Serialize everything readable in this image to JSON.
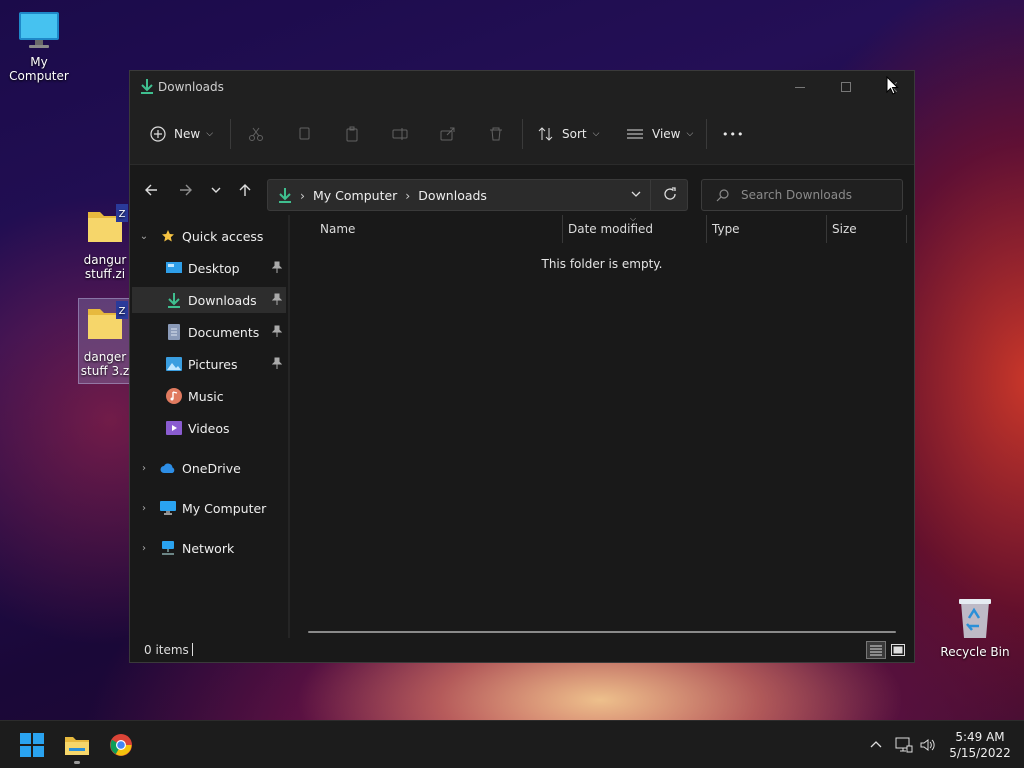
{
  "desktop": {
    "icons": [
      {
        "label": "My Computer"
      },
      {
        "label_line1": "dangur",
        "label_line2": "stuff.zi"
      },
      {
        "label_line1": "danger",
        "label_line2": "stuff 3.z"
      },
      {
        "label": "Recycle Bin"
      }
    ]
  },
  "window": {
    "title": "Downloads",
    "commands": {
      "new_label": "New",
      "sort_label": "Sort",
      "view_label": "View",
      "more_label": "•••"
    },
    "address": {
      "segments": [
        "My Computer",
        "Downloads"
      ],
      "separator": "›"
    },
    "search": {
      "placeholder": "Search Downloads"
    },
    "sidebar": {
      "quick_access": "Quick access",
      "items": [
        {
          "label": "Desktop",
          "pinned": true
        },
        {
          "label": "Downloads",
          "pinned": true,
          "active": true
        },
        {
          "label": "Documents",
          "pinned": true
        },
        {
          "label": "Pictures",
          "pinned": true
        },
        {
          "label": "Music"
        },
        {
          "label": "Videos"
        }
      ],
      "roots": [
        {
          "label": "OneDrive"
        },
        {
          "label": "My Computer"
        },
        {
          "label": "Network"
        }
      ]
    },
    "columns": [
      "Name",
      "Date modified",
      "Type",
      "Size"
    ],
    "empty_message": "This folder is empty.",
    "status": {
      "item_count": "0 items"
    }
  },
  "taskbar": {
    "clock_time": "5:49 AM",
    "clock_date": "5/15/2022"
  },
  "colors": {
    "accent_download": "#3fbf8f",
    "folder_yellow": "#f3c74a",
    "win_blue": "#2aa3f0"
  }
}
